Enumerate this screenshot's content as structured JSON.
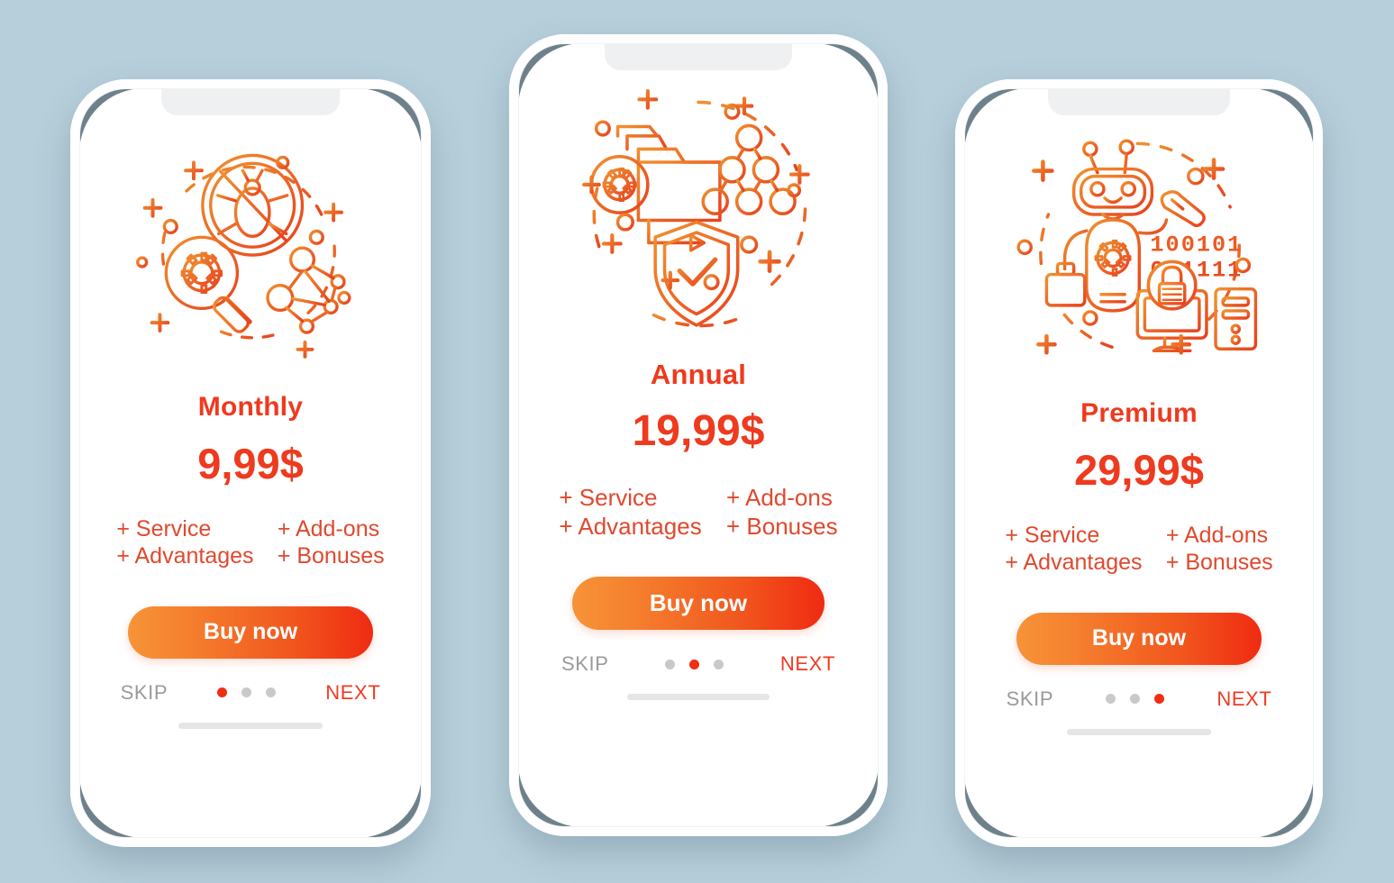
{
  "background_color": "#b7cfdb",
  "theme": {
    "accent_red": "#ee3a1e",
    "accent_orange": "#f79338",
    "feature_text": "#e0492e",
    "skip_gray": "#9a9a9a",
    "dot_inactive": "#c9c9c9",
    "phone_shell": "#ffffff",
    "phone_accent_slate": "#6e818b"
  },
  "screens": [
    {
      "id": "monthly",
      "illustration_name": "bug-blocked-magnifier-network-icon",
      "title": "Monthly",
      "price": "9,99$",
      "features": [
        "+ Service",
        "+ Add-ons",
        "+ Advantages",
        "+ Bonuses"
      ],
      "buy_label": "Buy now",
      "skip_label": "SKIP",
      "next_label": "NEXT",
      "dots": {
        "count": 3,
        "active_index": 0
      }
    },
    {
      "id": "annual",
      "illustration_name": "folder-gear-shield-check-network-icon",
      "title": "Annual",
      "price": "19,99$",
      "features": [
        "+ Service",
        "+ Add-ons",
        "+ Advantages",
        "+ Bonuses"
      ],
      "buy_label": "Buy now",
      "skip_label": "SKIP",
      "next_label": "NEXT",
      "dots": {
        "count": 3,
        "active_index": 1
      }
    },
    {
      "id": "premium",
      "illustration_name": "robot-binary-lock-monitor-icon",
      "title": "Premium",
      "price": "29,99$",
      "features": [
        "+ Service",
        "+ Add-ons",
        "+ Advantages",
        "+ Bonuses"
      ],
      "buy_label": "Buy now",
      "skip_label": "SKIP",
      "next_label": "NEXT",
      "dots": {
        "count": 3,
        "active_index": 2
      },
      "binary_line_1": "100101",
      "binary_line_2": "001111"
    }
  ]
}
